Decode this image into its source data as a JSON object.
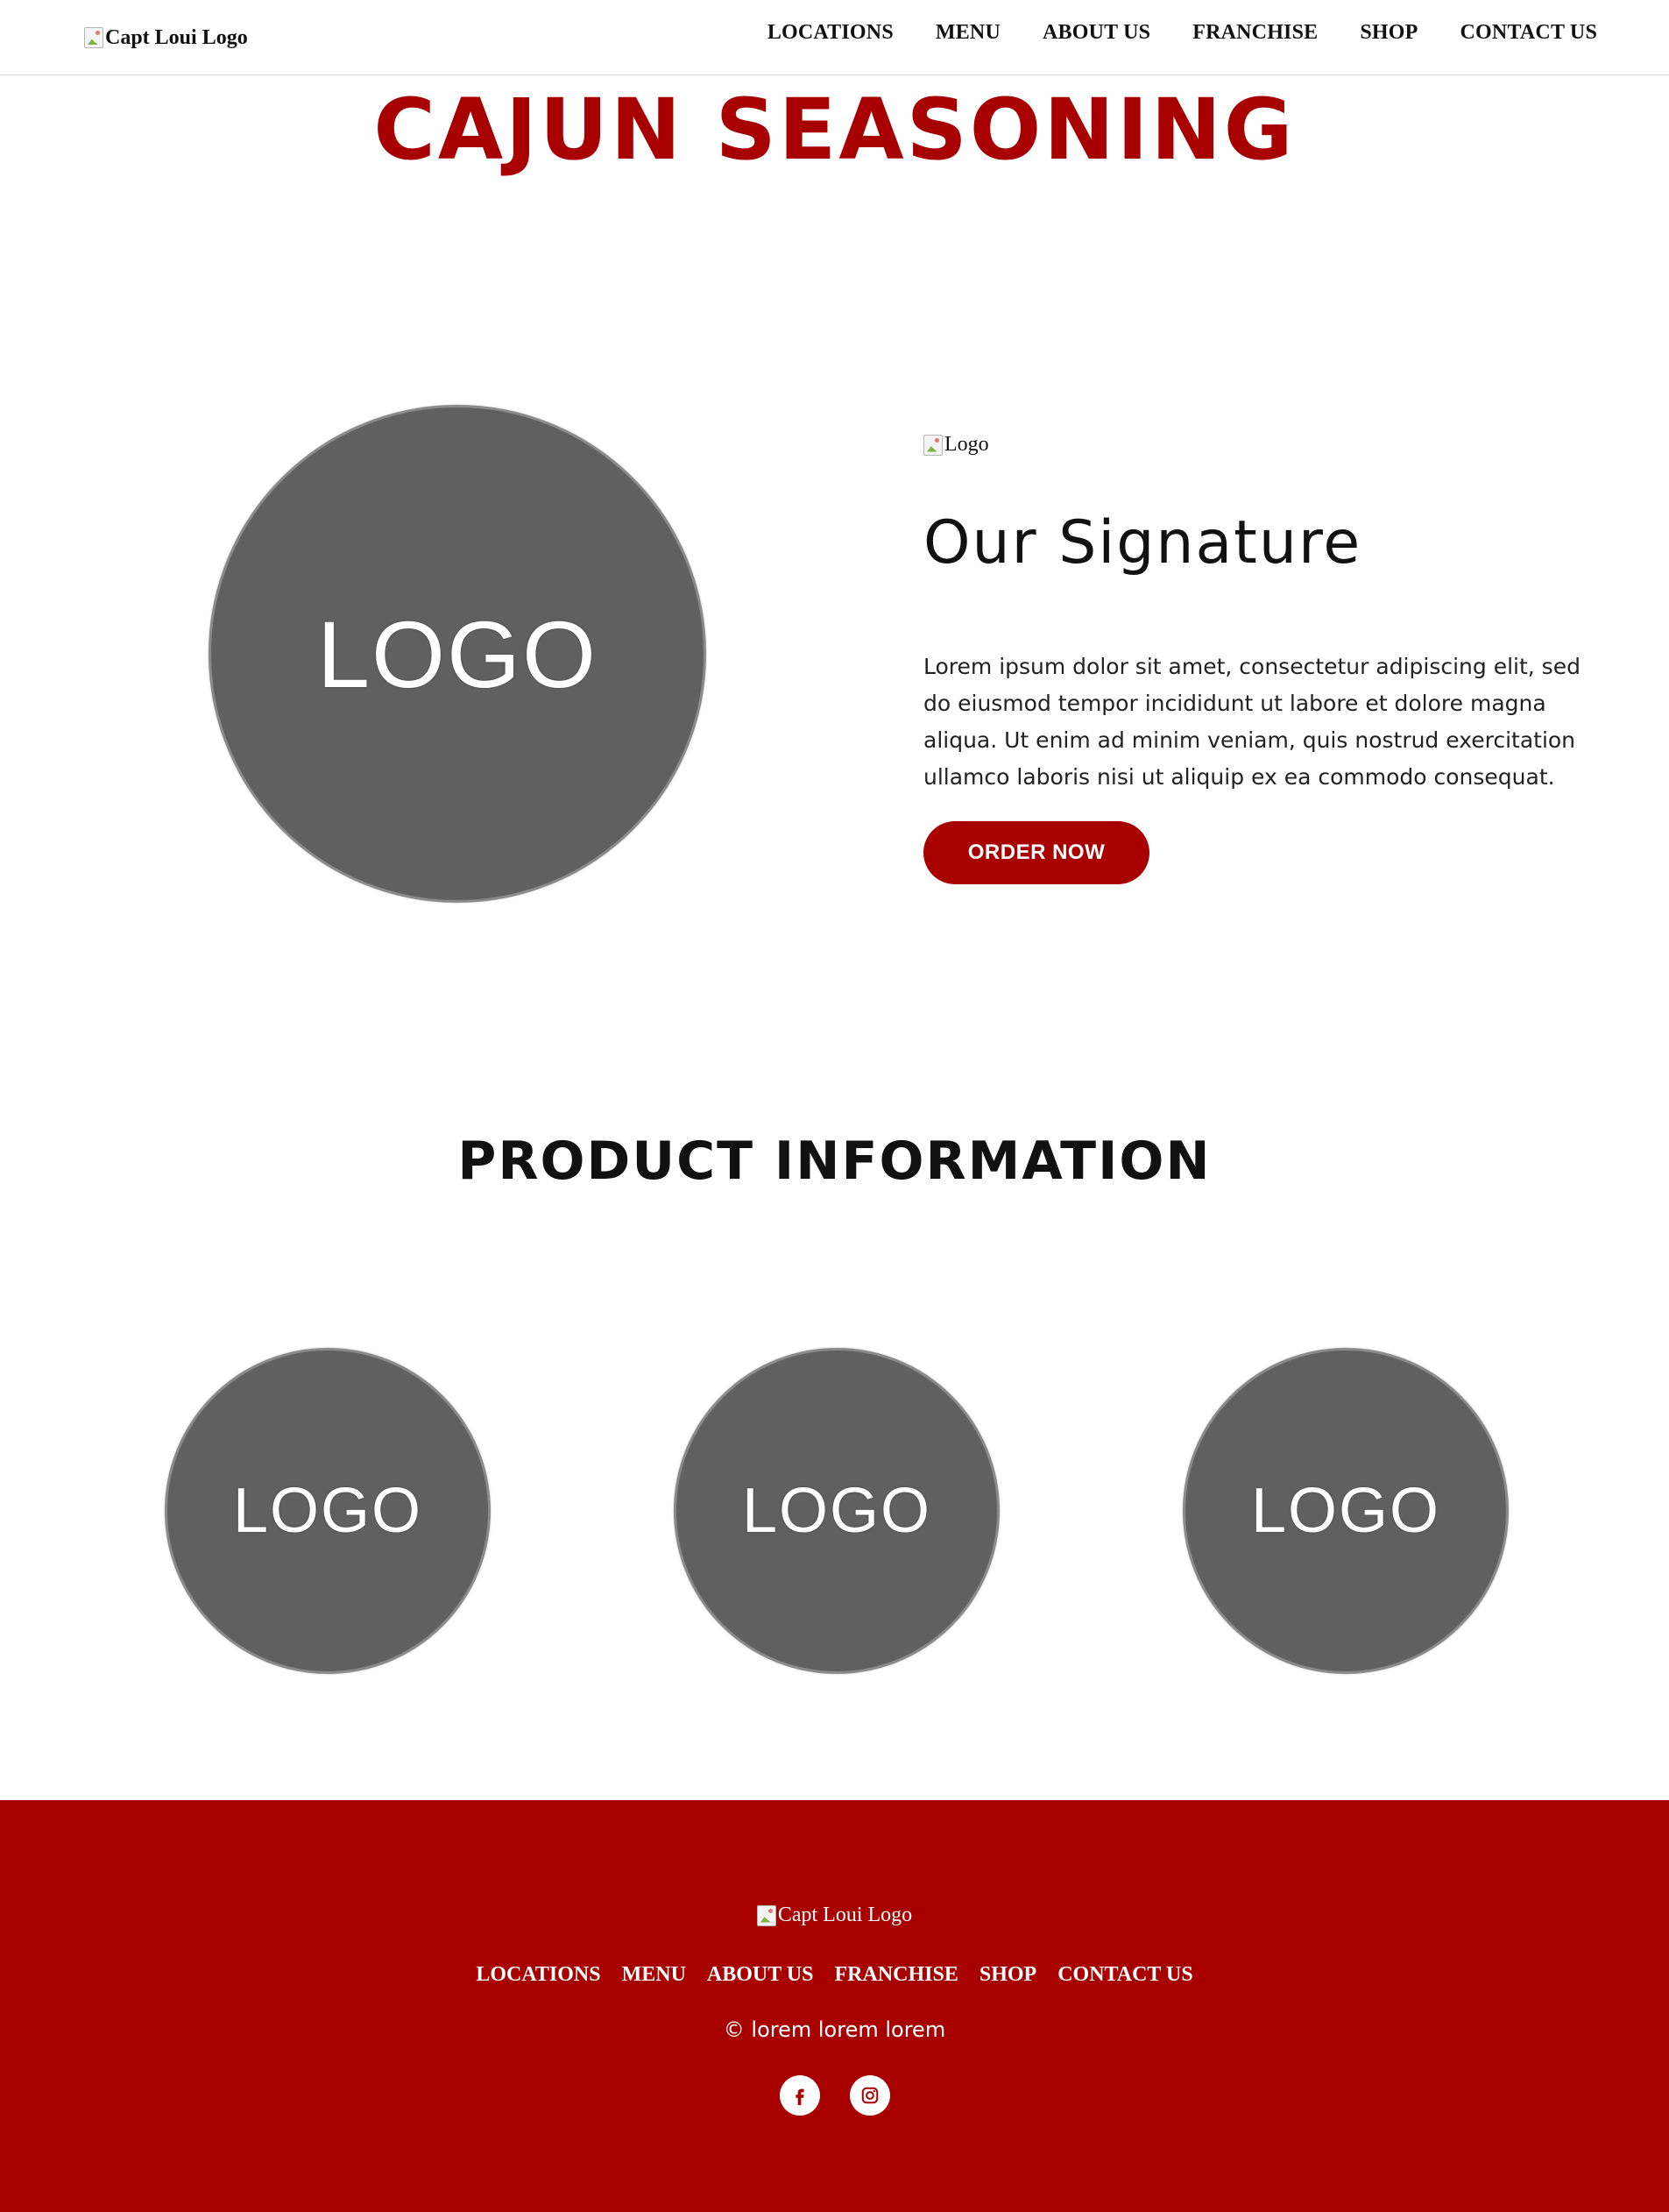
{
  "header": {
    "logo_alt": "Capt Loui Logo",
    "nav": [
      "LOCATIONS",
      "MENU",
      "ABOUT US",
      "FRANCHISE",
      "SHOP",
      "CONTACT US"
    ]
  },
  "hero": {
    "title": "CAJUN SEASONING"
  },
  "signature": {
    "image_text": "LOGO",
    "logo_alt": "Logo",
    "heading": "Our Signature",
    "body": "Lorem ipsum dolor sit amet, consectetur adipiscing elit, sed do eiusmod tempor incididunt ut labore et dolore magna aliqua. Ut enim ad minim veniam, quis nostrud exercitation ullamco laboris nisi ut aliquip ex ea commodo consequat.",
    "button": "ORDER NOW"
  },
  "product_info": {
    "heading": "PRODUCT INFORMATION",
    "items": [
      "LOGO",
      "LOGO",
      "LOGO"
    ]
  },
  "footer": {
    "logo_alt": "Capt Loui Logo",
    "nav": [
      "LOCATIONS",
      "MENU",
      "ABOUT US",
      "FRANCHISE",
      "SHOP",
      "CONTACT US"
    ],
    "copyright": "© lorem lorem lorem",
    "social": [
      "facebook-icon",
      "instagram-icon"
    ]
  },
  "colors": {
    "brand_red": "#a80000",
    "circle_gray": "#606060"
  }
}
